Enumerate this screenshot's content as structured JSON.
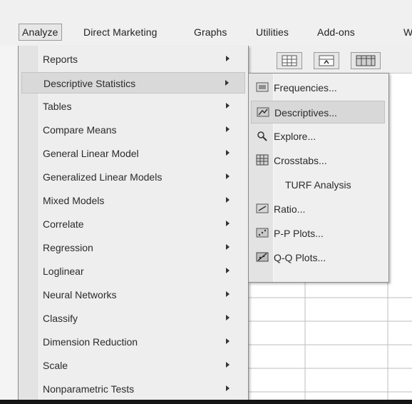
{
  "menubar": {
    "items": [
      {
        "label": "Analyze"
      },
      {
        "label": "Direct Marketing"
      },
      {
        "label": "Graphs"
      },
      {
        "label": "Utilities"
      },
      {
        "label": "Add-ons"
      },
      {
        "label": "W"
      }
    ]
  },
  "analyze_menu": {
    "items": [
      {
        "label": "Reports"
      },
      {
        "label": "Descriptive Statistics"
      },
      {
        "label": "Tables"
      },
      {
        "label": "Compare Means"
      },
      {
        "label": "General Linear Model"
      },
      {
        "label": "Generalized Linear Models"
      },
      {
        "label": "Mixed Models"
      },
      {
        "label": "Correlate"
      },
      {
        "label": "Regression"
      },
      {
        "label": "Loglinear"
      },
      {
        "label": "Neural Networks"
      },
      {
        "label": "Classify"
      },
      {
        "label": "Dimension Reduction"
      },
      {
        "label": "Scale"
      },
      {
        "label": "Nonparametric Tests"
      }
    ]
  },
  "descriptive_submenu": {
    "items": [
      {
        "label": "Frequencies...",
        "icon": "frequencies-icon"
      },
      {
        "label": "Descriptives...",
        "icon": "descriptives-icon"
      },
      {
        "label": "Explore...",
        "icon": "explore-icon"
      },
      {
        "label": "Crosstabs...",
        "icon": "crosstabs-icon"
      },
      {
        "label": "TURF Analysis",
        "icon": ""
      },
      {
        "label": "Ratio...",
        "icon": "ratio-icon"
      },
      {
        "label": "P-P Plots...",
        "icon": "pp-plots-icon"
      },
      {
        "label": "Q-Q Plots...",
        "icon": "qq-plots-icon"
      }
    ]
  }
}
